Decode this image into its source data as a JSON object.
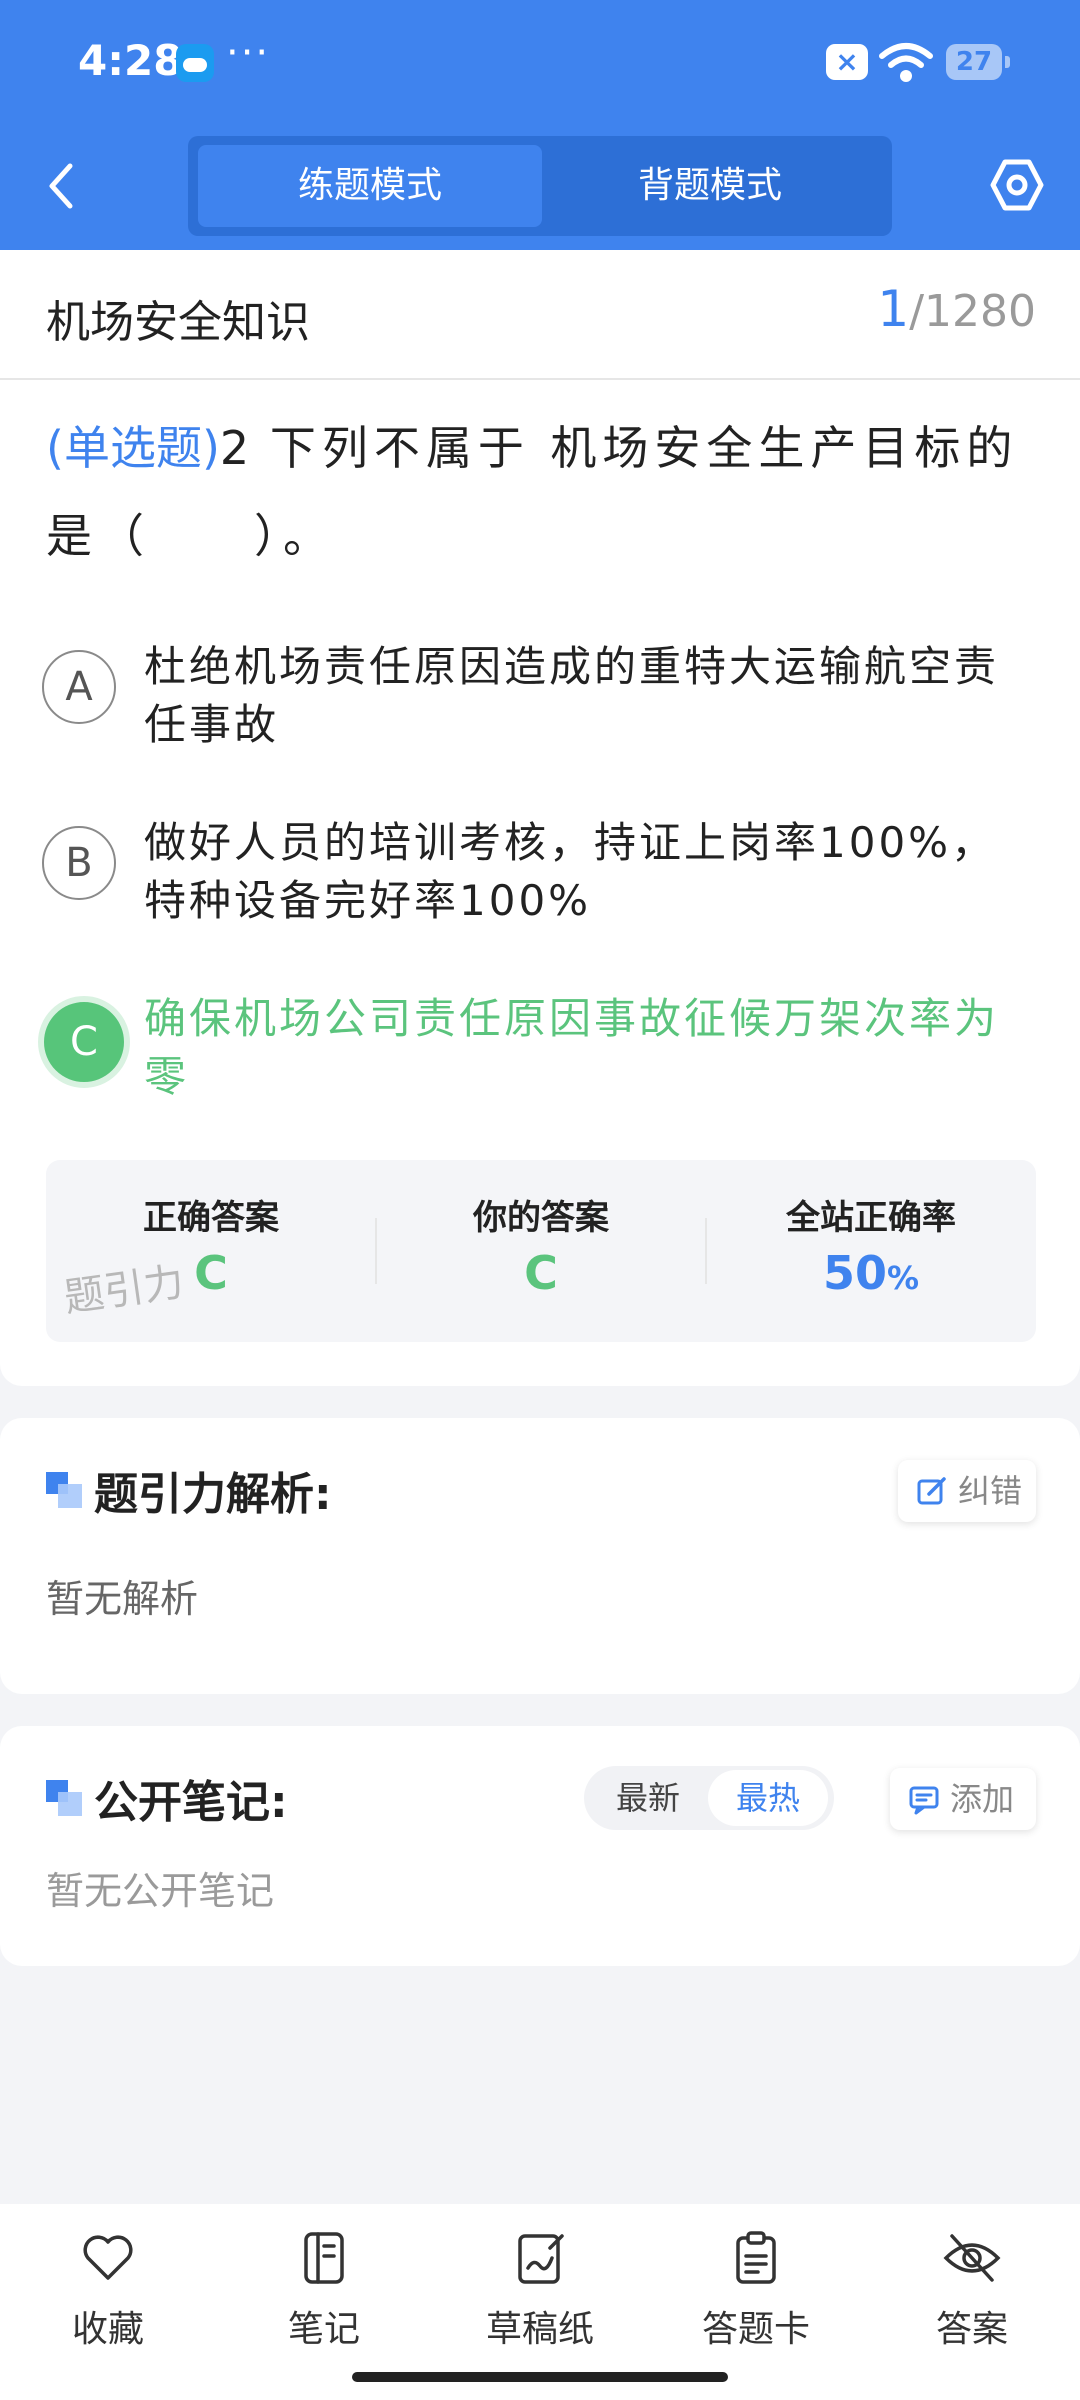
{
  "status_bar": {
    "time": "4:28",
    "dots": "···",
    "battery": "27"
  },
  "nav": {
    "modes": [
      "练题模式",
      "背题模式"
    ]
  },
  "header": {
    "subject": "机场安全知识",
    "current": "1",
    "total": "/1280"
  },
  "question": {
    "type": "(单选题)",
    "number": "2",
    "text": "下列不属于 机场安全生产目标的是（　　）。",
    "options": [
      {
        "letter": "A",
        "text": "杜绝机场责任原因造成的重特大运输航空责任事故"
      },
      {
        "letter": "B",
        "text": "做好人员的培训考核，持证上岗率100%，特种设备完好率100%"
      },
      {
        "letter": "C",
        "text": "确保机场公司责任原因事故征候万架次率为零"
      }
    ]
  },
  "answer": {
    "correct_label": "正确答案",
    "correct_value": "C",
    "yours_label": "你的答案",
    "yours_value": "C",
    "rate_label": "全站正确率",
    "rate_value": "50",
    "rate_unit": "%",
    "watermark": "题引力"
  },
  "analysis": {
    "title": "题引力解析:",
    "report_label": "纠错",
    "empty": "暂无解析"
  },
  "notes": {
    "title": "公开笔记:",
    "sort_latest": "最新",
    "sort_hot": "最热",
    "add_label": "添加",
    "empty": "暂无公开笔记"
  },
  "bottom_bar": [
    {
      "label": "收藏"
    },
    {
      "label": "笔记"
    },
    {
      "label": "草稿纸"
    },
    {
      "label": "答题卡"
    },
    {
      "label": "答案"
    }
  ],
  "colors": {
    "primary": "#3f83ee",
    "correct": "#5bc47d"
  }
}
